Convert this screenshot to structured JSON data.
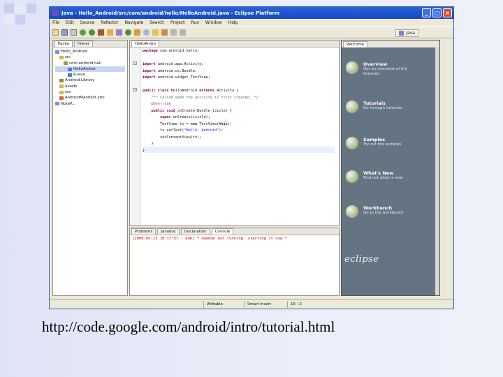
{
  "window": {
    "title": "Java - Hello_Android/src/com/android/hello/HelloAndroid.java - Eclipse Platform"
  },
  "menu": [
    "File",
    "Edit",
    "Source",
    "Refactor",
    "Navigate",
    "Search",
    "Project",
    "Run",
    "Window",
    "Help"
  ],
  "perspective_label": "Java",
  "explorer": {
    "tabs": [
      "Packa",
      "Hierar"
    ],
    "tree": [
      "Hello_Android",
      "src",
      "com.android.hell",
      "HelloAndroi",
      "R.java",
      "Android Library",
      "assets",
      "res",
      "AndroidManifest.xml",
      "NoteP..."
    ]
  },
  "editor": {
    "tab": "HelloAndro",
    "lines": [
      "package com.android.hello;",
      "",
      "import android.app.Activity;",
      "import android.os.Bundle;",
      "import android.widget.TextView;",
      "",
      "public class HelloAndroid extends Activity {",
      "    /** Called when the activity is first created. */",
      "    @Override",
      "    public void onCreate(Bundle icicle) {",
      "        super.onCreate(icicle);",
      "        TextView tv = new TextView(this);",
      "        tv.setText(\"Hello, Android\");",
      "        setContentView(tv);",
      "    }",
      "}"
    ]
  },
  "bottom": {
    "tabs": [
      "Problems",
      "Javadoc",
      "Declaration",
      "Console"
    ],
    "console_line": "[2008-03-13 10:17:57 - adb] * daemon not running. starting it now *"
  },
  "welcome": {
    "tab": "Welcome",
    "items": [
      {
        "title": "Overview",
        "desc": "Get an overview of the features"
      },
      {
        "title": "Tutorials",
        "desc": "Go through tutorials"
      },
      {
        "title": "Samples",
        "desc": "Try out the samples"
      },
      {
        "title": "What's New",
        "desc": "Find out what is new"
      },
      {
        "title": "Workbench",
        "desc": "Go to the workbench"
      }
    ],
    "logo": "eclipse"
  },
  "status": {
    "writable": "Writable",
    "insert": "Smart Insert",
    "position": "16 : 2"
  },
  "caption": "http://code.google.com/android/intro/tutorial.html"
}
